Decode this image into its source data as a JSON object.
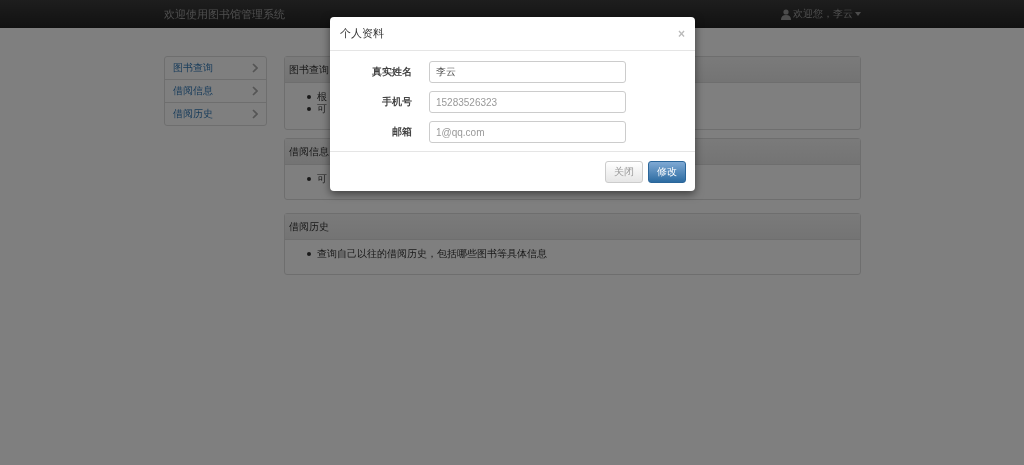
{
  "navbar": {
    "title": "欢迎使用图书馆管理系统",
    "user_menu": "欢迎您，李云"
  },
  "sidebar": {
    "items": [
      {
        "label": "图书查询"
      },
      {
        "label": "借阅信息"
      },
      {
        "label": "借阅历史"
      }
    ]
  },
  "panels": [
    {
      "heading": "图书查询",
      "items": [
        "根",
        "可"
      ]
    },
    {
      "heading": "借阅信息",
      "items": [
        "可"
      ]
    },
    {
      "heading": "借阅历史",
      "items": [
        "查询自己以往的借阅历史，包括哪些图书等具体信息"
      ]
    }
  ],
  "modal": {
    "title": "个人资料",
    "close": "×",
    "fields": [
      {
        "label": "真实姓名",
        "value": "李云"
      },
      {
        "label": "手机号",
        "placeholder": "15283526323"
      },
      {
        "label": "邮箱",
        "placeholder": "1@qq.com"
      }
    ],
    "buttons": [
      {
        "label": "关闭",
        "kind": "default"
      },
      {
        "label": "修改",
        "kind": "primary"
      }
    ]
  }
}
